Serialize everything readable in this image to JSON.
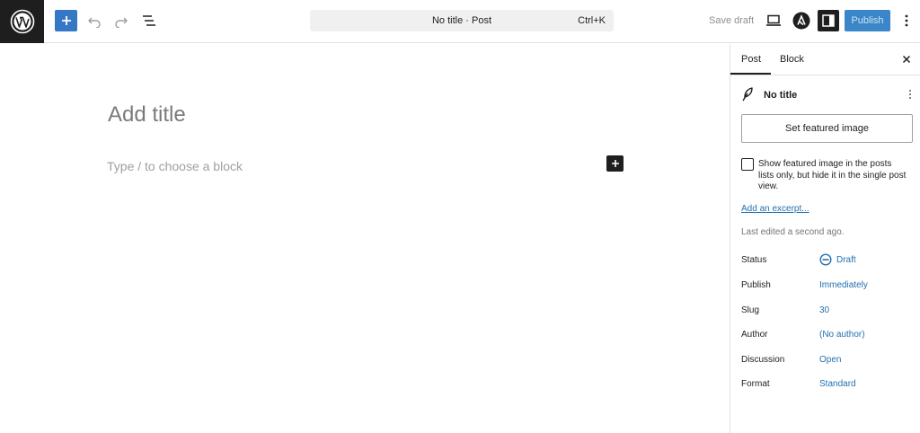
{
  "toolbar": {
    "document_title": "No title · Post",
    "shortcut": "Ctrl+K",
    "save_draft": "Save draft",
    "publish": "Publish"
  },
  "editor": {
    "title_placeholder": "Add title",
    "block_placeholder": "Type / to choose a block"
  },
  "sidebar": {
    "tabs": [
      {
        "label": "Post"
      },
      {
        "label": "Block"
      }
    ],
    "post_name": "No title",
    "featured_image_button": "Set featured image",
    "featured_checkbox_label": "Show featured image in the posts lists only, but hide it in the single post view.",
    "excerpt_link": "Add an excerpt...",
    "last_edited": "Last edited a second ago.",
    "meta": [
      {
        "key": "Status",
        "value": "Draft"
      },
      {
        "key": "Publish",
        "value": "Immediately"
      },
      {
        "key": "Slug",
        "value": "30"
      },
      {
        "key": "Author",
        "value": "(No author)"
      },
      {
        "key": "Discussion",
        "value": "Open"
      },
      {
        "key": "Format",
        "value": "Standard"
      }
    ]
  },
  "colors": {
    "accent": "#3478c6",
    "link": "#2271b1",
    "dark": "#1e1e1e"
  },
  "icons": [
    "wordpress-logo-icon",
    "plus-icon",
    "undo-icon",
    "redo-icon",
    "list-view-icon",
    "desktop-preview-icon",
    "astra-icon",
    "sidebar-toggle-icon",
    "more-vertical-icon",
    "close-icon",
    "post-feather-icon",
    "status-draft-icon"
  ]
}
